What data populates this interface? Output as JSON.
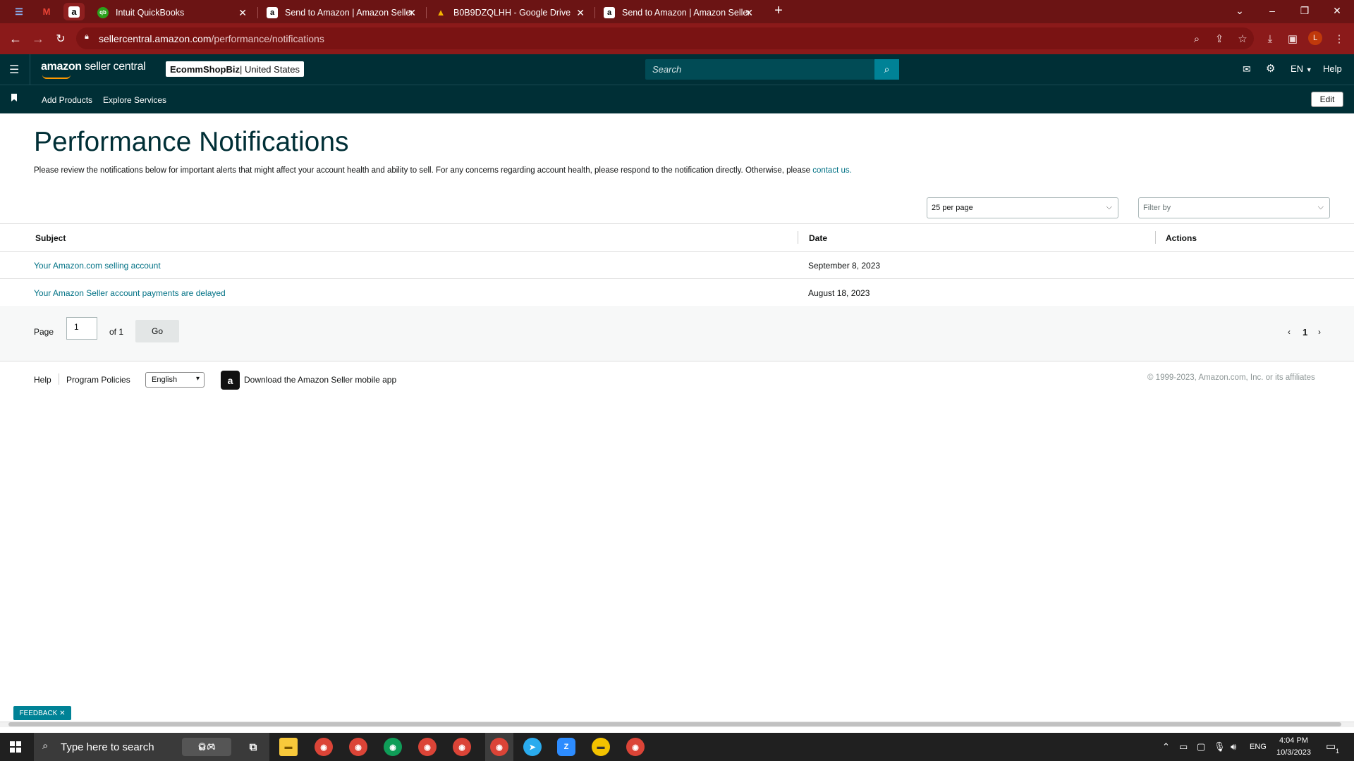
{
  "browser": {
    "pinned_tabs": [
      {
        "icon": "calendar-icon",
        "glyph": "☰"
      },
      {
        "icon": "gmail-icon",
        "glyph": "M"
      },
      {
        "icon": "amazon-icon",
        "glyph": "a"
      }
    ],
    "tabs": [
      {
        "title": "Intuit QuickBooks",
        "icon": "quickbooks-icon",
        "glyph": "qb",
        "color": "#2ca01c"
      },
      {
        "title": "Send to Amazon | Amazon Seller",
        "icon": "amazon-icon",
        "glyph": "a",
        "color": "#ffffff"
      },
      {
        "title": "B0B9DZQLHH - Google Drive",
        "icon": "google-drive-icon",
        "glyph": "▲",
        "color": "#f4b400"
      },
      {
        "title": "Send to Amazon | Amazon Seller",
        "icon": "amazon-icon",
        "glyph": "a",
        "color": "#ffffff"
      }
    ],
    "url_host": "sellercentral.amazon.com",
    "url_path": "/performance/notifications",
    "profile_initial": "L"
  },
  "header": {
    "logo_bold": "amazon",
    "logo_rest": " seller central",
    "account_name": "EcommShopBiz",
    "account_region": " | United States",
    "search_placeholder": "Search",
    "language": "EN",
    "help": "Help"
  },
  "subnav": {
    "links": [
      "Add Products",
      "Explore Services"
    ],
    "edit": "Edit"
  },
  "page": {
    "title": "Performance Notifications",
    "intro": "Please review the notifications below for important alerts that might affect your account health and ability to sell. For any concerns regarding account health, please respond to the notification directly. Otherwise, please ",
    "intro_link": "contact us.",
    "per_page": "25 per page",
    "filter_placeholder": "Filter by"
  },
  "table": {
    "headers": {
      "subject": "Subject",
      "date": "Date",
      "actions": "Actions"
    },
    "rows": [
      {
        "subject": "Your Amazon.com selling account",
        "date": "September 8, 2023"
      },
      {
        "subject": "Your Amazon Seller account payments are delayed",
        "date": "August 18, 2023"
      }
    ]
  },
  "pagination": {
    "page_label": "Page",
    "page_value": "1",
    "of_label": "of 1",
    "go": "Go",
    "current": "1"
  },
  "footer": {
    "help": "Help",
    "program_policies": "Program Policies",
    "language": "English",
    "app_text": "Download the Amazon Seller mobile app",
    "copyright": "© 1999-2023, Amazon.com, Inc. or its affiliates"
  },
  "feedback": "FEEDBACK",
  "taskbar": {
    "search_placeholder": "Type here to search",
    "language": "ENG",
    "time": "4:04 PM",
    "date": "10/3/2023",
    "notification_count": "1"
  }
}
